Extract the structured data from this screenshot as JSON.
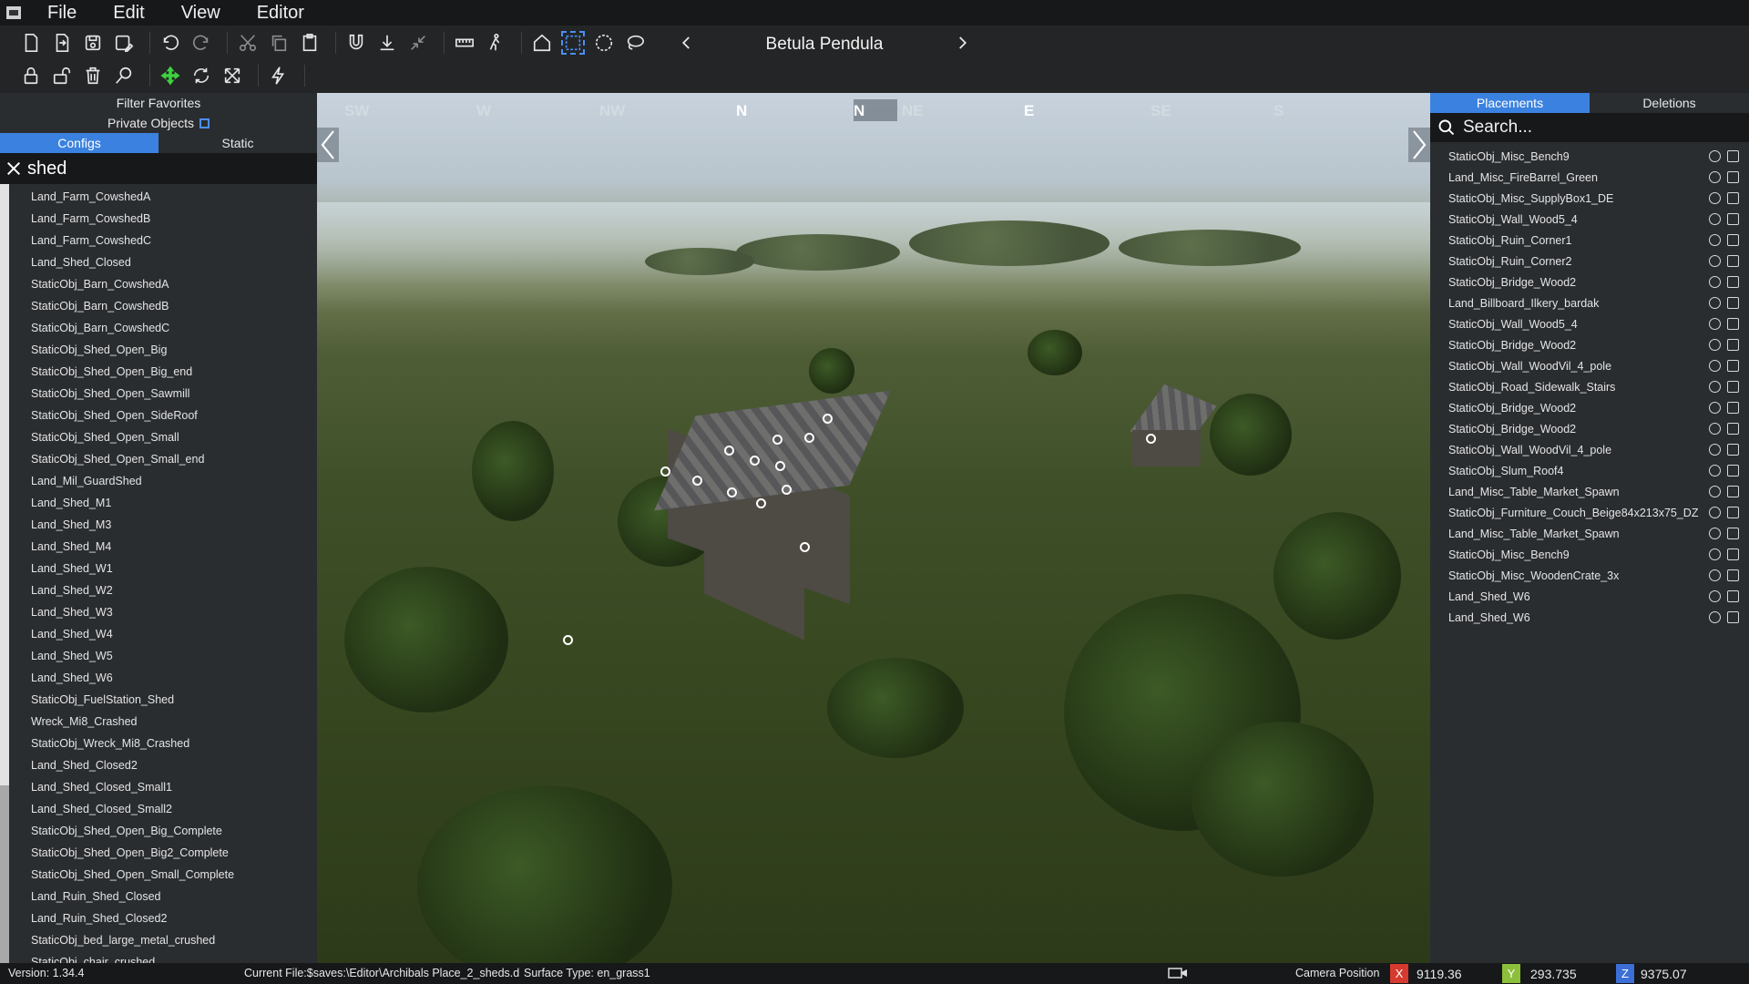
{
  "menu": [
    "File",
    "Edit",
    "View",
    "Editor"
  ],
  "toolbar": {
    "nav_title": "Betula Pendula",
    "row1_icons": [
      "new-file-icon",
      "open-file-icon",
      "save-icon",
      "save-as-icon",
      "undo-icon",
      "redo-icon",
      "cut-icon",
      "copy-icon",
      "paste-icon",
      "magnet-icon",
      "drop-to-ground-icon",
      "collapse-icon",
      "ruler-icon",
      "walk-icon",
      "home-icon",
      "box-select-icon",
      "circle-select-icon",
      "lasso-select-icon"
    ],
    "row2_icons": [
      "lock-icon",
      "unlock-icon",
      "delete-icon",
      "search-object-icon",
      "move-icon",
      "rotate-icon",
      "scale-icon",
      "lightning-icon"
    ]
  },
  "left": {
    "filter_favorites": "Filter Favorites",
    "private_objects": "Private Objects",
    "tabs": [
      "Configs",
      "Static"
    ],
    "search_value": "shed",
    "items": [
      "Land_Farm_CowshedA",
      "Land_Farm_CowshedB",
      "Land_Farm_CowshedC",
      "Land_Shed_Closed",
      "StaticObj_Barn_CowshedA",
      "StaticObj_Barn_CowshedB",
      "StaticObj_Barn_CowshedC",
      "StaticObj_Shed_Open_Big",
      "StaticObj_Shed_Open_Big_end",
      "StaticObj_Shed_Open_Sawmill",
      "StaticObj_Shed_Open_SideRoof",
      "StaticObj_Shed_Open_Small",
      "StaticObj_Shed_Open_Small_end",
      "Land_Mil_GuardShed",
      "Land_Shed_M1",
      "Land_Shed_M3",
      "Land_Shed_M4",
      "Land_Shed_W1",
      "Land_Shed_W2",
      "Land_Shed_W3",
      "Land_Shed_W4",
      "Land_Shed_W5",
      "Land_Shed_W6",
      "StaticObj_FuelStation_Shed",
      "Wreck_Mi8_Crashed",
      "StaticObj_Wreck_Mi8_Crashed",
      "Land_Shed_Closed2",
      "Land_Shed_Closed_Small1",
      "Land_Shed_Closed_Small2",
      "StaticObj_Shed_Open_Big_Complete",
      "StaticObj_Shed_Open_Big2_Complete",
      "StaticObj_Shed_Open_Small_Complete",
      "Land_Ruin_Shed_Closed",
      "Land_Ruin_Shed_Closed2",
      "StaticObj_bed_large_metal_crushed",
      "StaticObj_chair_crushed"
    ]
  },
  "compass": {
    "labels": [
      {
        "t": "SW",
        "main": false
      },
      {
        "t": "W",
        "main": false
      },
      {
        "t": "NW",
        "main": false
      },
      {
        "t": "N",
        "main": true
      },
      {
        "t": "N",
        "main": true
      },
      {
        "t": "NE",
        "main": false
      },
      {
        "t": "E",
        "main": true
      },
      {
        "t": "SE",
        "main": false
      },
      {
        "t": "S",
        "main": false
      }
    ]
  },
  "right": {
    "tabs": [
      "Placements",
      "Deletions"
    ],
    "search_placeholder": "Search...",
    "items": [
      "StaticObj_Misc_Bench9",
      "Land_Misc_FireBarrel_Green",
      "StaticObj_Misc_SupplyBox1_DE",
      "StaticObj_Wall_Wood5_4",
      "StaticObj_Ruin_Corner1",
      "StaticObj_Ruin_Corner2",
      "StaticObj_Bridge_Wood2",
      "Land_Billboard_Ilkery_bardak",
      "StaticObj_Wall_Wood5_4",
      "StaticObj_Bridge_Wood2",
      "StaticObj_Wall_WoodVil_4_pole",
      "StaticObj_Road_Sidewalk_Stairs",
      "StaticObj_Bridge_Wood2",
      "StaticObj_Bridge_Wood2",
      "StaticObj_Wall_WoodVil_4_pole",
      "StaticObj_Slum_Roof4",
      "Land_Misc_Table_Market_Spawn",
      "StaticObj_Furniture_Couch_Beige84x213x75_DZ",
      "Land_Misc_Table_Market_Spawn",
      "StaticObj_Misc_Bench9",
      "StaticObj_Misc_WoodenCrate_3x",
      "Land_Shed_W6",
      "Land_Shed_W6"
    ]
  },
  "status": {
    "version": "Version:  1.34.4",
    "current_file": "Current File:$saves:\\Editor\\Archibals Place_2_sheds.d",
    "surface": "Surface Type: en_grass1",
    "camera_label": "Camera Position",
    "x_label": "X",
    "x": "9119.36",
    "y_label": "Y",
    "y": "293.735",
    "z_label": "Z",
    "z": "9375.07",
    "colors": {
      "x": "#d63a2f",
      "y": "#8cbf3a",
      "z": "#3b6fd6"
    }
  }
}
